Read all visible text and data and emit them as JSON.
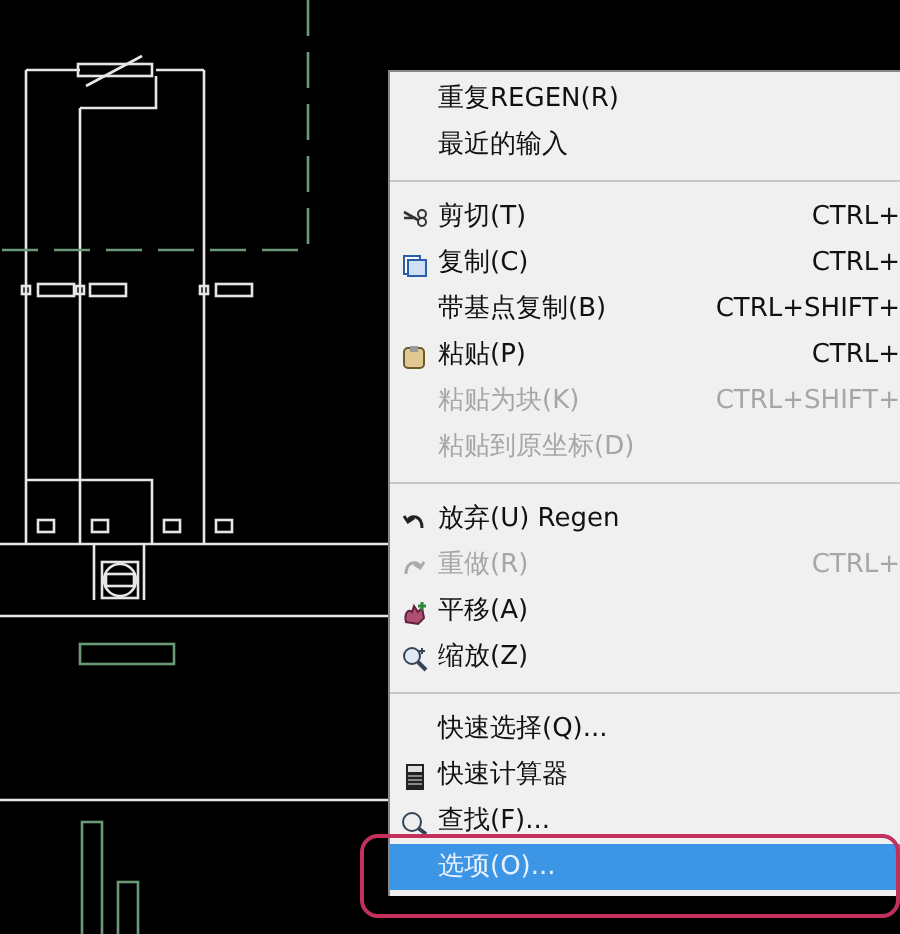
{
  "context_menu": {
    "items": [
      {
        "kind": "item",
        "label": "重复REGEN(R)",
        "disabled": false,
        "selected": false
      },
      {
        "kind": "item",
        "label": "最近的输入",
        "disabled": false,
        "selected": false
      },
      {
        "kind": "separator"
      },
      {
        "kind": "item",
        "label": "剪切(T)",
        "shortcut": "CTRL+",
        "disabled": false,
        "selected": false
      },
      {
        "kind": "item",
        "label": "复制(C)",
        "shortcut": "CTRL+",
        "disabled": false,
        "selected": false
      },
      {
        "kind": "item",
        "label": "带基点复制(B)",
        "shortcut": "CTRL+SHIFT+",
        "disabled": false,
        "selected": false
      },
      {
        "kind": "item",
        "label": "粘贴(P)",
        "shortcut": "CTRL+",
        "disabled": false,
        "selected": false
      },
      {
        "kind": "item",
        "label": "粘贴为块(K)",
        "shortcut": "CTRL+SHIFT+",
        "disabled": true,
        "selected": false
      },
      {
        "kind": "item",
        "label": "粘贴到原坐标(D)",
        "disabled": true,
        "selected": false
      },
      {
        "kind": "separator"
      },
      {
        "kind": "item",
        "label": "放弃(U) Regen",
        "disabled": false,
        "selected": false
      },
      {
        "kind": "item",
        "label": "重做(R)",
        "shortcut": "CTRL+",
        "disabled": true,
        "selected": false
      },
      {
        "kind": "item",
        "label": "平移(A)",
        "disabled": false,
        "selected": false
      },
      {
        "kind": "item",
        "label": "缩放(Z)",
        "disabled": false,
        "selected": false
      },
      {
        "kind": "separator"
      },
      {
        "kind": "item",
        "label": "快速选择(Q)...",
        "disabled": false,
        "selected": false
      },
      {
        "kind": "item",
        "label": "快速计算器",
        "disabled": false,
        "selected": false
      },
      {
        "kind": "item",
        "label": "查找(F)...",
        "disabled": false,
        "selected": false
      },
      {
        "kind": "item",
        "label": "选项(O)...",
        "disabled": false,
        "selected": true
      }
    ]
  },
  "annotation": {
    "kind": "highlight_frame"
  }
}
